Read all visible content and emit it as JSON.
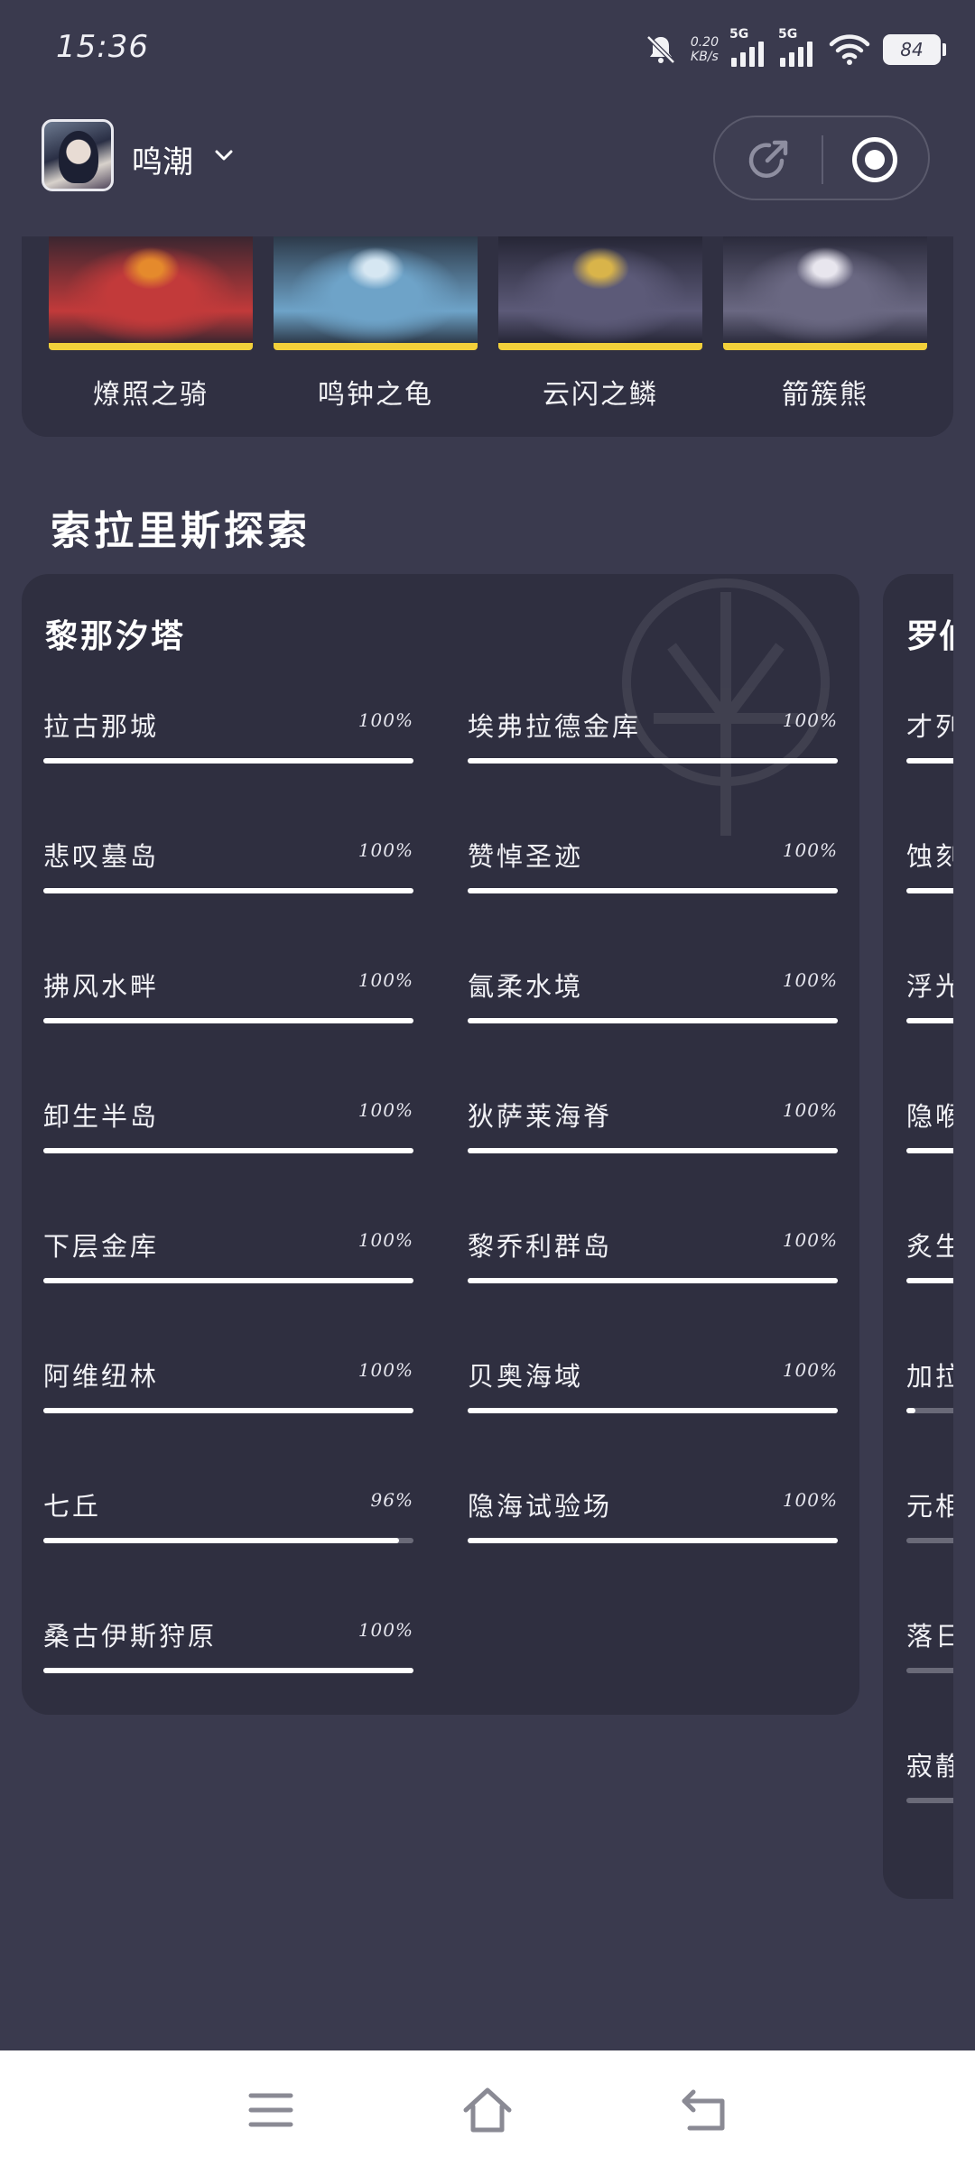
{
  "status_bar": {
    "time": "15:36",
    "net_speed_value": "0.20",
    "net_speed_unit": "KB/s",
    "sim1": "5G",
    "sim2": "5G",
    "battery": "84"
  },
  "header": {
    "game_name": "鸣潮"
  },
  "bosses": [
    {
      "name": "燎照之骑",
      "palette": [
        "#3b2630",
        "#c23a3a",
        "#e58a2c"
      ]
    },
    {
      "name": "鸣钟之龟",
      "palette": [
        "#2d3a4a",
        "#6ea3c8",
        "#d6e7f2"
      ]
    },
    {
      "name": "云闪之鳞",
      "palette": [
        "#262636",
        "#5c5a78",
        "#d9b44a"
      ]
    },
    {
      "name": "箭簇熊",
      "palette": [
        "#2b2b3c",
        "#6a6882",
        "#e8e6ee"
      ]
    }
  ],
  "section_title": "索拉里斯探索",
  "region": {
    "title": "黎那汐塔",
    "areas": [
      {
        "name": "拉古那城",
        "pct_label": "100%",
        "progress": 100
      },
      {
        "name": "埃弗拉德金库",
        "pct_label": "100%",
        "progress": 100
      },
      {
        "name": "悲叹墓岛",
        "pct_label": "100%",
        "progress": 100
      },
      {
        "name": "赞悼圣迹",
        "pct_label": "100%",
        "progress": 100
      },
      {
        "name": "拂风水畔",
        "pct_label": "100%",
        "progress": 100
      },
      {
        "name": "氤柔水境",
        "pct_label": "100%",
        "progress": 100
      },
      {
        "name": "卸生半岛",
        "pct_label": "100%",
        "progress": 100
      },
      {
        "name": "狄萨莱海脊",
        "pct_label": "100%",
        "progress": 100
      },
      {
        "name": "下层金库",
        "pct_label": "100%",
        "progress": 100
      },
      {
        "name": "黎乔利群岛",
        "pct_label": "100%",
        "progress": 100
      },
      {
        "name": "阿维纽林",
        "pct_label": "100%",
        "progress": 100
      },
      {
        "name": "贝奥海域",
        "pct_label": "100%",
        "progress": 100
      },
      {
        "name": "七丘",
        "pct_label": "96%",
        "progress": 96
      },
      {
        "name": "隐海试验场",
        "pct_label": "100%",
        "progress": 100
      },
      {
        "name": "桑古伊斯狩原",
        "pct_label": "100%",
        "progress": 100
      }
    ]
  },
  "next_region": {
    "title": "罗伯",
    "items": [
      {
        "name": "才列",
        "progress": 100
      },
      {
        "name": "蚀刻",
        "progress": 100
      },
      {
        "name": "浮光",
        "progress": 100
      },
      {
        "name": "隐喉",
        "progress": 100
      },
      {
        "name": "炙生",
        "progress": 100
      },
      {
        "name": "加拉",
        "progress": 5
      },
      {
        "name": "元相",
        "progress": 0
      },
      {
        "name": "落日",
        "progress": 0
      },
      {
        "name": "寂静",
        "progress": 0
      }
    ]
  }
}
